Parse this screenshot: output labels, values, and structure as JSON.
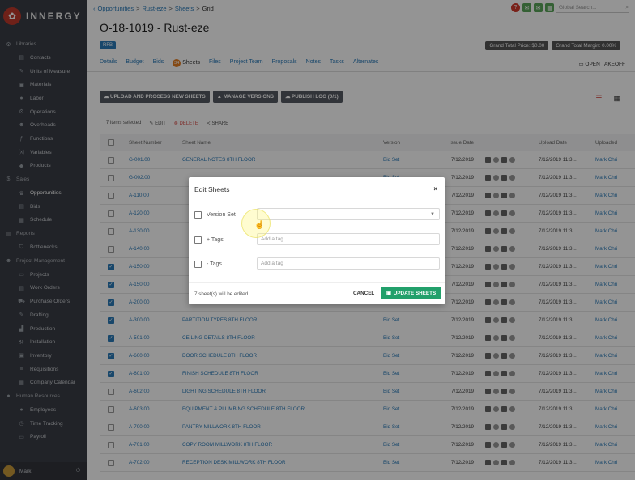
{
  "app": {
    "name": "INNERGY",
    "user": "Mark"
  },
  "sidebar": {
    "sections": [
      {
        "label": "Libraries",
        "icon": "gear-icon",
        "items": [
          {
            "label": "Contacts",
            "icon": "contacts-icon"
          },
          {
            "label": "Units of Measure",
            "icon": "ruler-icon"
          },
          {
            "label": "Materials",
            "icon": "cube-icon"
          },
          {
            "label": "Labor",
            "icon": "person-icon"
          },
          {
            "label": "Operations",
            "icon": "cog-icon"
          },
          {
            "label": "Overheads",
            "icon": "people-icon"
          },
          {
            "label": "Functions",
            "icon": "function-icon"
          },
          {
            "label": "Variables",
            "icon": "variable-icon"
          },
          {
            "label": "Products",
            "icon": "product-icon"
          }
        ]
      },
      {
        "label": "Sales",
        "icon": "dollar-icon",
        "items": [
          {
            "label": "Opportunities",
            "icon": "trophy-icon",
            "active": true
          },
          {
            "label": "Bids",
            "icon": "document-icon"
          },
          {
            "label": "Schedule",
            "icon": "calendar-icon"
          }
        ]
      },
      {
        "label": "Reports",
        "icon": "report-icon",
        "items": [
          {
            "label": "Bottlenecks",
            "icon": "bottleneck-icon"
          }
        ]
      },
      {
        "label": "Project Management",
        "icon": "people-icon",
        "items": [
          {
            "label": "Projects",
            "icon": "folder-icon"
          },
          {
            "label": "Work Orders",
            "icon": "clipboard-icon"
          },
          {
            "label": "Purchase Orders",
            "icon": "cart-icon"
          },
          {
            "label": "Drafting",
            "icon": "pencil-icon"
          },
          {
            "label": "Production",
            "icon": "factory-icon"
          },
          {
            "label": "Installation",
            "icon": "hammer-icon"
          },
          {
            "label": "Inventory",
            "icon": "box-icon"
          },
          {
            "label": "Requisitions",
            "icon": "list-icon"
          },
          {
            "label": "Company Calendar",
            "icon": "calendar-icon"
          }
        ]
      },
      {
        "label": "Human Resources",
        "icon": "person-icon",
        "items": [
          {
            "label": "Employees",
            "icon": "person-icon"
          },
          {
            "label": "Time Tracking",
            "icon": "clock-icon"
          },
          {
            "label": "Payroll",
            "icon": "money-icon"
          }
        ]
      }
    ]
  },
  "header": {
    "breadcrumb": [
      "Opportunities",
      "Rust-eze",
      "Sheets",
      "Grid"
    ],
    "search_placeholder": "Global Search...",
    "title": "O-18-1019 - Rust-eze",
    "badge": "RFB",
    "grand_total_price": "Grand Total Price: $0.00",
    "grand_total_margin": "Grand Total Margin: 0.00%",
    "tabs": [
      "Details",
      "Budget",
      "Bids",
      "Sheets",
      "Files",
      "Project Team",
      "Proposals",
      "Notes",
      "Tasks",
      "Alternates"
    ],
    "sheets_count": "34",
    "active_tab": "Sheets",
    "open_takeoff": "OPEN TAKEOFF"
  },
  "toolbar": {
    "upload": "UPLOAD AND PROCESS NEW SHEETS",
    "manage": "MANAGE VERSIONS",
    "publish": "PUBLISH LOG (0/1)"
  },
  "selection": {
    "text": "7 items selected",
    "edit": "EDIT",
    "delete": "DELETE",
    "share": "SHARE"
  },
  "table": {
    "headers": [
      "Sheet Number",
      "Sheet Name",
      "Version",
      "Issue Date",
      "",
      "Upload Date",
      "Uploaded"
    ],
    "rows": [
      {
        "num": "G-001.00",
        "name": "GENERAL NOTES 8TH FLOOR",
        "version": "Bid Set",
        "issue": "7/12/2019",
        "upload": "7/12/2019 11:3...",
        "by": "Mark Chri",
        "checked": false
      },
      {
        "num": "G-002.00",
        "name": "",
        "version": "Bid Set",
        "issue": "7/12/2019",
        "upload": "7/12/2019 11:3...",
        "by": "Mark Chri",
        "checked": false
      },
      {
        "num": "A-110.00",
        "name": "",
        "version": "Bid Set",
        "issue": "7/12/2019",
        "upload": "7/12/2019 11:3...",
        "by": "Mark Chri",
        "checked": false
      },
      {
        "num": "A-120.00",
        "name": "",
        "version": "Bid Set",
        "issue": "7/12/2019",
        "upload": "7/12/2019 11:3...",
        "by": "Mark Chri",
        "checked": false
      },
      {
        "num": "A-130.00",
        "name": "",
        "version": "Bid Set",
        "issue": "7/12/2019",
        "upload": "7/12/2019 11:3...",
        "by": "Mark Chri",
        "checked": false
      },
      {
        "num": "A-140.00",
        "name": "",
        "version": "Bid Set",
        "issue": "7/12/2019",
        "upload": "7/12/2019 11:3...",
        "by": "Mark Chri",
        "checked": false
      },
      {
        "num": "A-150.00",
        "name": "",
        "version": "Bid Set",
        "issue": "7/12/2019",
        "upload": "7/12/2019 11:3...",
        "by": "Mark Chri",
        "checked": true
      },
      {
        "num": "A-150.00",
        "name": "",
        "version": "Bid Set",
        "issue": "7/12/2019",
        "upload": "7/12/2019 11:3...",
        "by": "Mark Chri",
        "checked": true
      },
      {
        "num": "A-200.00",
        "name": "",
        "version": "Bid Set",
        "issue": "7/12/2019",
        "upload": "7/12/2019 11:3...",
        "by": "Mark Chri",
        "checked": true
      },
      {
        "num": "A-300.00",
        "name": "PARTITION TYPES 8TH FLOOR",
        "version": "Bid Set",
        "issue": "7/12/2019",
        "upload": "7/12/2019 11:3...",
        "by": "Mark Chri",
        "checked": true
      },
      {
        "num": "A-501.00",
        "name": "CEILING DETAILS 8TH FLOOR",
        "version": "Bid Set",
        "issue": "7/12/2019",
        "upload": "7/12/2019 11:3...",
        "by": "Mark Chri",
        "checked": true
      },
      {
        "num": "A-600.00",
        "name": "DOOR SCHEDULE 8TH FLOOR",
        "version": "Bid Set",
        "issue": "7/12/2019",
        "upload": "7/12/2019 11:3...",
        "by": "Mark Chri",
        "checked": true
      },
      {
        "num": "A-601.00",
        "name": "FINISH SCHEDULE 8TH FLOOR",
        "version": "Bid Set",
        "issue": "7/12/2019",
        "upload": "7/12/2019 11:3...",
        "by": "Mark Chri",
        "checked": true
      },
      {
        "num": "A-602.00",
        "name": "LIGHTING SCHEDULE 8TH FLOOR",
        "version": "Bid Set",
        "issue": "7/12/2019",
        "upload": "7/12/2019 11:3...",
        "by": "Mark Chri",
        "checked": false
      },
      {
        "num": "A-603.00",
        "name": "EQUIPMENT & PLUMBING SCHEDULE 8TH FLOOR",
        "version": "Bid Set",
        "issue": "7/12/2019",
        "upload": "7/12/2019 11:3...",
        "by": "Mark Chri",
        "checked": false
      },
      {
        "num": "A-700.00",
        "name": "PANTRY MILLWORK 8TH FLOOR",
        "version": "Bid Set",
        "issue": "7/12/2019",
        "upload": "7/12/2019 11:3...",
        "by": "Mark Chri",
        "checked": false
      },
      {
        "num": "A-701.00",
        "name": "COPY ROOM MILLWORK 8TH FLOOR",
        "version": "Bid Set",
        "issue": "7/12/2019",
        "upload": "7/12/2019 11:3...",
        "by": "Mark Chri",
        "checked": false
      },
      {
        "num": "A-702.00",
        "name": "RECEPTION DESK MILLWORK 8TH FLOOR",
        "version": "Bid Set",
        "issue": "7/12/2019",
        "upload": "7/12/2019 11:3...",
        "by": "Mark Chri",
        "checked": false
      }
    ]
  },
  "modal": {
    "title": "Edit Sheets",
    "close": "×",
    "version_set_label": "Version Set",
    "tags_add_label": "+ Tags",
    "tags_add_placeholder": "Add a tag",
    "tags_remove_label": "- Tags",
    "tags_remove_placeholder": "Add a tag",
    "edited_text": "7 sheet(s) will be edited",
    "cancel": "CANCEL",
    "update": "UPDATE SHEETS"
  },
  "colors": {
    "primary": "#2a7ab8",
    "success": "#22a06b",
    "sidebar": "#3a3d45",
    "danger": "#d9534f",
    "accent": "#e67e22"
  }
}
